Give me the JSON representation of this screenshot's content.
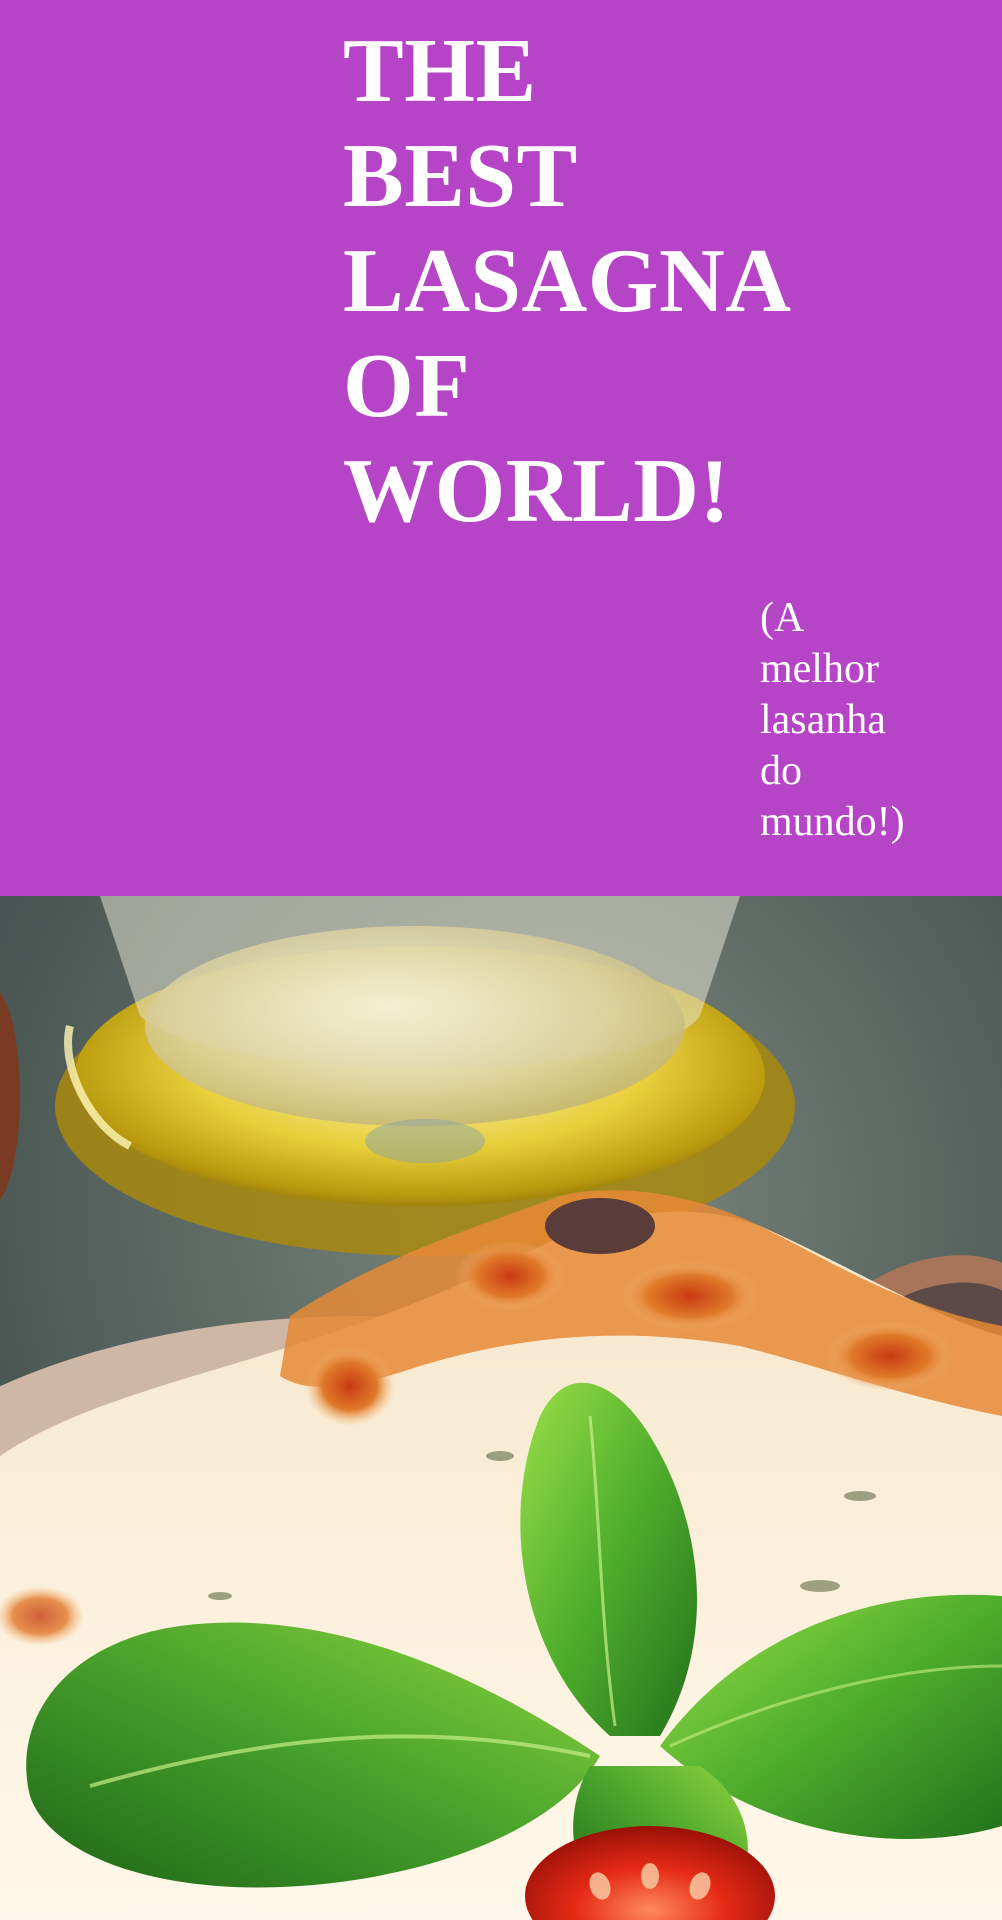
{
  "colors": {
    "background": "#b544c6",
    "text": "#ffffff"
  },
  "header": {
    "title_lines": [
      "THE",
      "BEST",
      "LASAGNA",
      "OF",
      "WORLD!"
    ],
    "subtitle_lines": [
      "(A",
      "melhor",
      "lasanha",
      "do",
      "mundo!)"
    ]
  },
  "photo": {
    "description_icon": "lasagna-photo"
  }
}
